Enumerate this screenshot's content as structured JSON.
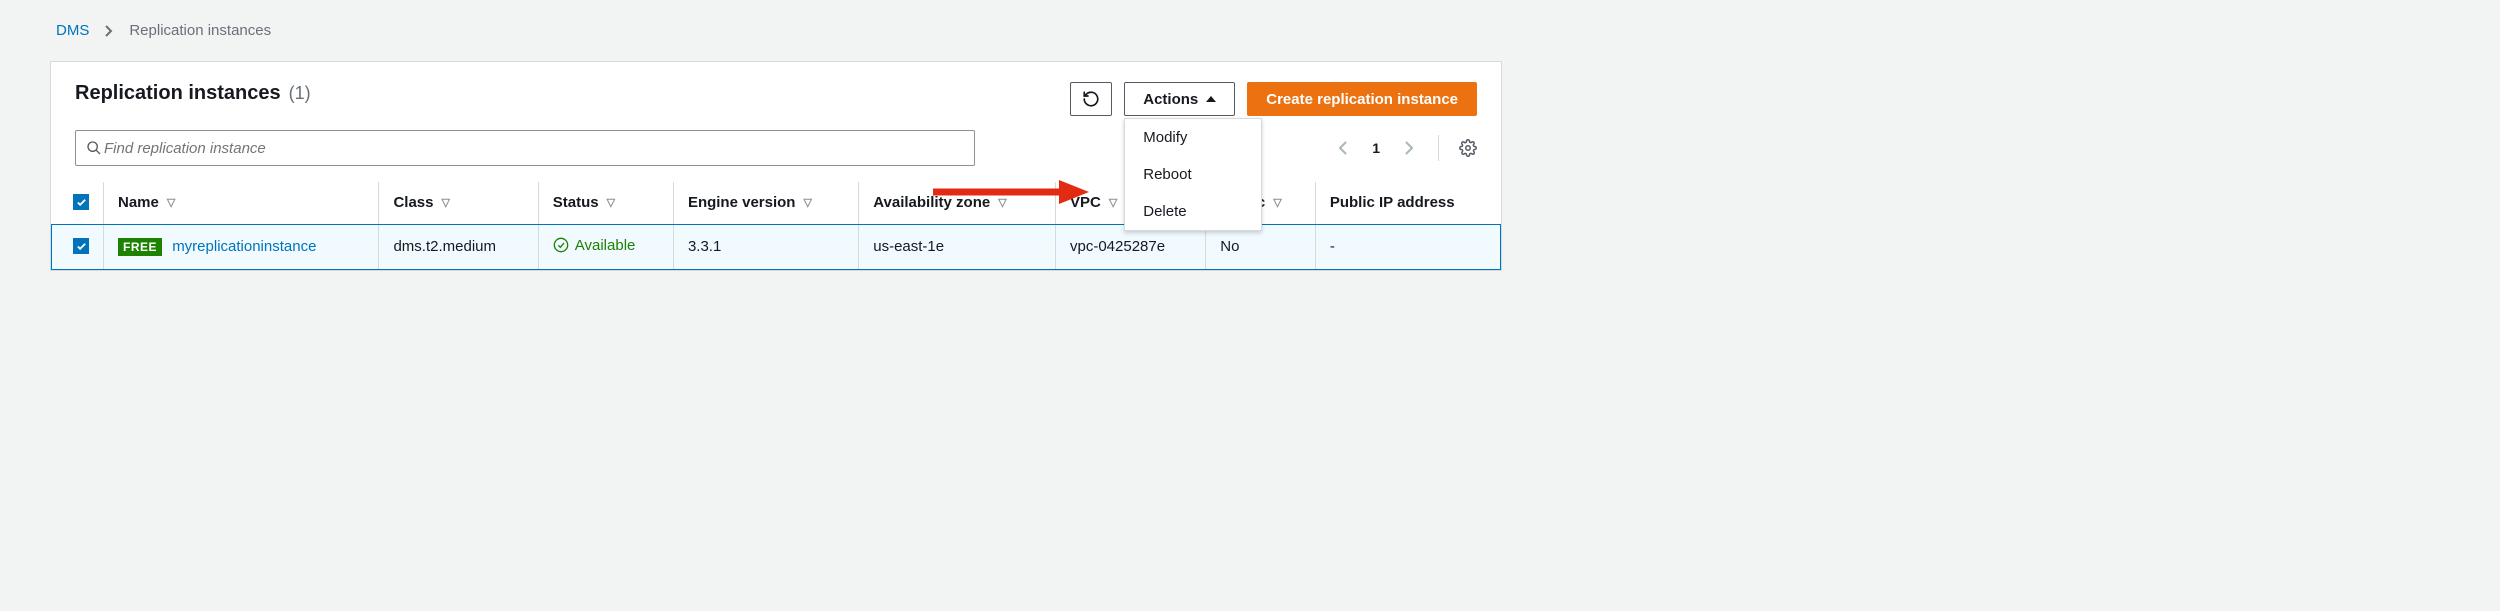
{
  "breadcrumb": {
    "root": "DMS",
    "current": "Replication instances"
  },
  "header": {
    "title": "Replication instances",
    "count_display": "(1)",
    "actions_label": "Actions",
    "create_label": "Create replication instance"
  },
  "search": {
    "placeholder": "Find replication instance"
  },
  "pager": {
    "page": "1"
  },
  "actions_menu": {
    "items": [
      "Modify",
      "Reboot",
      "Delete"
    ]
  },
  "table": {
    "columns": [
      "Name",
      "Class",
      "Status",
      "Engine version",
      "Availability zone",
      "VPC",
      "Public",
      "Public IP address"
    ],
    "rows": [
      {
        "selected": true,
        "free_badge": "FREE",
        "name": "myreplicationinstance",
        "class": "dms.t2.medium",
        "status": "Available",
        "engine_version": "3.3.1",
        "az": "us-east-1e",
        "vpc": "vpc-0425287e",
        "public": "No",
        "public_ip": "-"
      }
    ]
  }
}
